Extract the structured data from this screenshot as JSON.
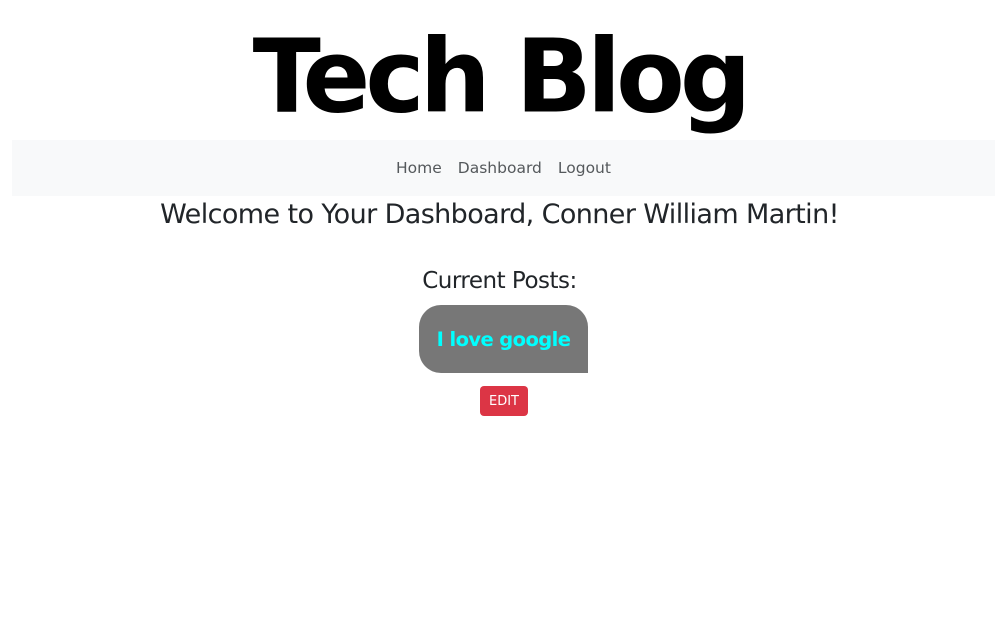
{
  "header": {
    "site_title": "Tech Blog"
  },
  "nav": {
    "items": [
      {
        "label": "Home"
      },
      {
        "label": "Dashboard"
      },
      {
        "label": "Logout"
      }
    ]
  },
  "main": {
    "welcome_text": "Welcome to Your Dashboard, Conner William Martin!",
    "posts_heading": "Current Posts:",
    "posts": [
      {
        "title": "I love google",
        "edit_label": "EDIT"
      }
    ]
  },
  "colors": {
    "post_card_bg": "#777777",
    "post_title": "#00ffff",
    "edit_button": "#dc3545",
    "navbar_bg": "#f8f9fa"
  }
}
